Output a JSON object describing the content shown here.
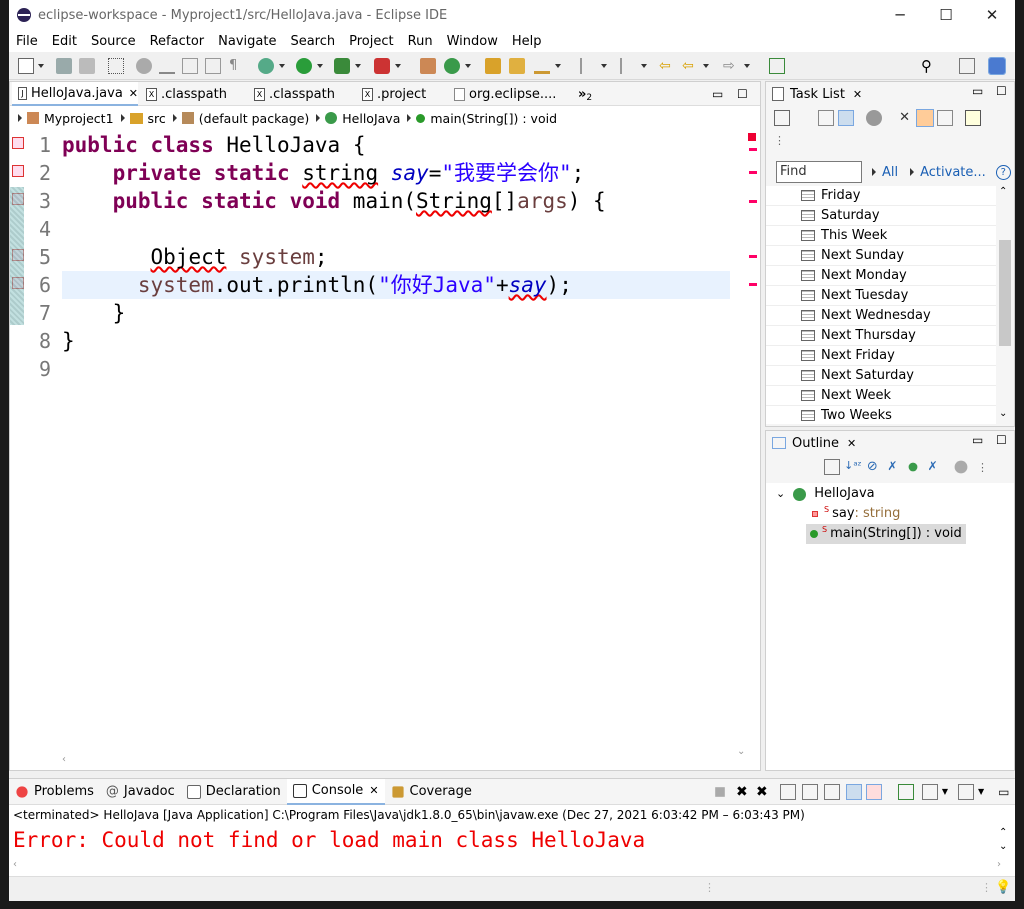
{
  "window": {
    "title": "eclipse-workspace - Myproject1/src/HelloJava.java - Eclipse IDE",
    "minimize": "─",
    "maximize": "☐",
    "close": "✕"
  },
  "menu": [
    "File",
    "Edit",
    "Source",
    "Refactor",
    "Navigate",
    "Search",
    "Project",
    "Run",
    "Window",
    "Help"
  ],
  "editor": {
    "tabs": [
      {
        "label": "HelloJava.java",
        "active": true,
        "close": "✕"
      },
      {
        "label": ".classpath"
      },
      {
        "label": ".classpath"
      },
      {
        "label": ".project"
      },
      {
        "label": "org.eclipse...."
      }
    ],
    "overflow": "»",
    "overflow_count": "2",
    "breadcrumb": [
      "Myproject1",
      "src",
      "(default package)",
      "HelloJava",
      "main(String[]) : void"
    ],
    "line_numbers": [
      "1",
      "2",
      "3",
      "4",
      "5",
      "6",
      "7",
      "8",
      "9"
    ],
    "highlighted_line": 6,
    "code": {
      "l1_kw": "public class ",
      "l1_name": "HelloJava",
      "l1_rest": " {",
      "l2_indent": "    ",
      "l2_kw": "private static ",
      "l2_type": "string",
      "l2_sp": " ",
      "l2_field": "say",
      "l2_eq": "=",
      "l2_str": "\"我要学会你\"",
      "l2_end": ";",
      "l3_indent": "    ",
      "l3_kw": "public static void ",
      "l3_main": "main(",
      "l3_type": "String",
      "l3_rest": "[]",
      "l3_arg": "args",
      "l3_end": ") {",
      "l5_indent": "       ",
      "l5_type": "Object",
      "l5_sp": " ",
      "l5_var": "system",
      "l5_end": ";",
      "l6_indent": "      ",
      "l6_var": "system",
      "l6_mid": ".out.println(",
      "l6_str": "\"你好Java\"",
      "l6_plus": "+",
      "l6_field": "say",
      "l6_end": ");",
      "l7": "    }",
      "l8": "}"
    }
  },
  "task_list": {
    "title": "Task List",
    "close": "✕",
    "find_placeholder": "Find",
    "all_link": "All",
    "activate_link": "Activate...",
    "items": [
      "Friday",
      "Saturday",
      "This Week",
      "Next Sunday",
      "Next Monday",
      "Next Tuesday",
      "Next Wednesday",
      "Next Thursday",
      "Next Friday",
      "Next Saturday",
      "Next Week",
      "Two Weeks"
    ]
  },
  "outline": {
    "title": "Outline",
    "close": "✕",
    "class_name": "HelloJava",
    "field_name": "say",
    "field_type": " : string",
    "method": "main(String[]) : void"
  },
  "bottom": {
    "tabs": [
      "Problems",
      "Javadoc",
      "Declaration",
      "Console",
      "Coverage"
    ],
    "active_tab": "Console",
    "close": "✕",
    "status": "<terminated> HelloJava [Java Application] C:\\Program Files\\Java\\jdk1.8.0_65\\bin\\javaw.exe  (Dec 27, 2021 6:03:42 PM – 6:03:43 PM)",
    "error": "Error: Could not find or load main class HelloJava"
  },
  "colors": {
    "keyword": "#7f0055",
    "string": "#2a00ff",
    "field": "#0000c0",
    "error": "#e00000",
    "highlight_line": "#e8f2fe"
  }
}
